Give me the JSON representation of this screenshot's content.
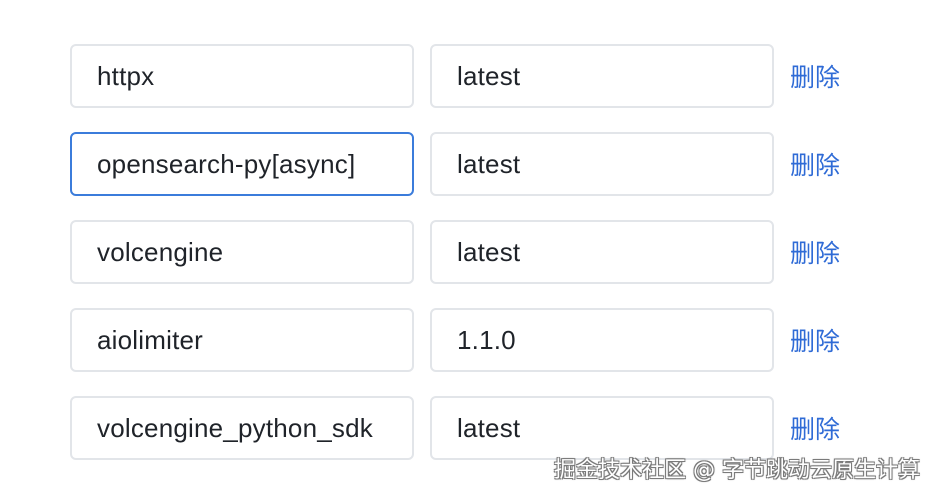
{
  "packages": [
    {
      "name": "httpx",
      "version": "latest",
      "delete_label": "删除",
      "focused": false
    },
    {
      "name": "opensearch-py[async]",
      "version": "latest",
      "delete_label": "删除",
      "focused": true
    },
    {
      "name": "volcengine",
      "version": "latest",
      "delete_label": "删除",
      "focused": false
    },
    {
      "name": "aiolimiter",
      "version": "1.1.0",
      "delete_label": "删除",
      "focused": false
    },
    {
      "name": "volcengine_python_sdk",
      "version": "latest",
      "delete_label": "删除",
      "focused": false
    }
  ],
  "watermark": "掘金技术社区 @ 字节跳动云原生计算",
  "colors": {
    "focus_border": "#3b7cdb",
    "link": "#2f6bd6",
    "border": "#e2e5e9",
    "text": "#1f2329"
  }
}
